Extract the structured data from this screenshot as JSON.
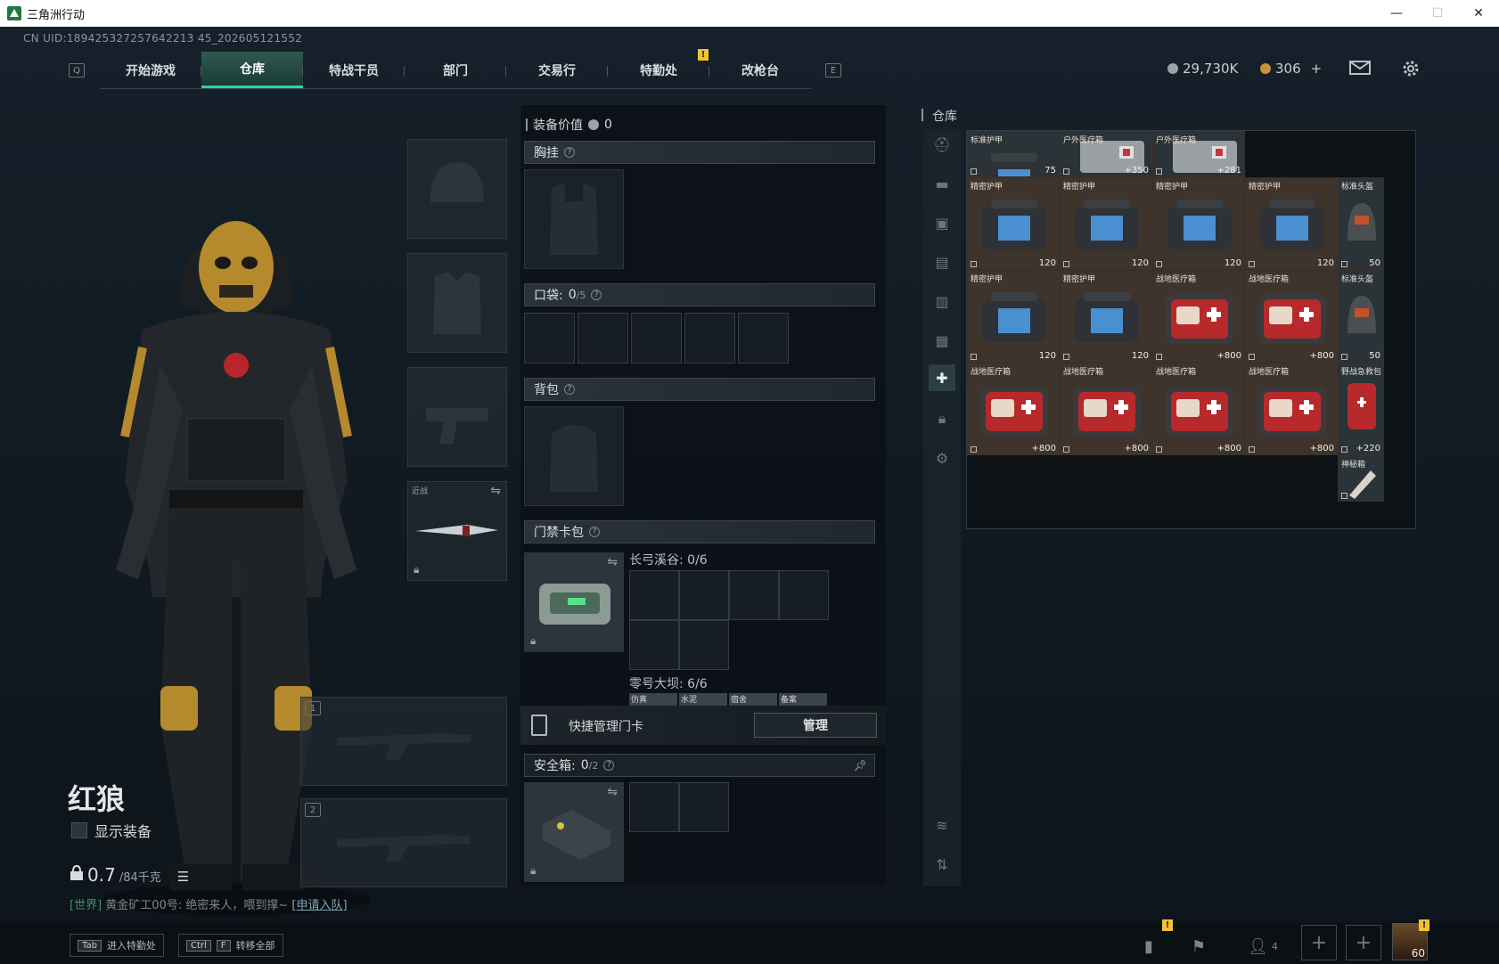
{
  "window": {
    "title": "三角洲行动",
    "min": "—",
    "max": "☐",
    "close": "✕"
  },
  "uid": "CN UID:189425327257642213 45_202605121552",
  "nav": {
    "left_key": "Q",
    "right_key": "E",
    "tabs": [
      "开始游戏",
      "仓库",
      "特战干员",
      "部门",
      "交易行",
      "特勤处",
      "改枪台"
    ],
    "active": 1,
    "badge": "!"
  },
  "currency": {
    "silver": "29,730K",
    "gold": "306",
    "plus": "+"
  },
  "character": {
    "name": "红狼",
    "show_equipment": "显示装备",
    "weight": "0.7",
    "weight_max": "/84千克"
  },
  "chat": {
    "channel": "[世界]",
    "msg": "黄金矿工00号: 绝密来人，喂到撑~",
    "join": "[申请入队]"
  },
  "equip_slots": {
    "melee_label": "近战",
    "weapon1": "1",
    "weapon2": "2"
  },
  "loadout": {
    "value_label": "装备价值",
    "value": "0",
    "chest": "胸挂",
    "pocket_label": "口袋:",
    "pocket_value": "0",
    "pocket_max": "/5",
    "backpack": "背包",
    "keycard_label": "门禁卡包",
    "keycard_area1": "长弓溪谷: 0/6",
    "keycard_area2": "零号大坝: 6/6",
    "keycard_chips": [
      "仿真",
      "水泥",
      "宿舍",
      "备案"
    ],
    "quick_manage": "快捷管理门卡",
    "manage_btn": "管理",
    "safebox_label": "安全箱:",
    "safebox_value": "0",
    "safebox_max": "/2"
  },
  "warehouse": {
    "title": "仓库",
    "items": [
      {
        "name": "标准护甲",
        "value": "75",
        "bg": "gr"
      },
      {
        "name": "户外医疗箱",
        "value": "+350",
        "bg": "gr"
      },
      {
        "name": "户外医疗箱",
        "value": "+281",
        "bg": "gr"
      },
      {
        "name": "精密护甲",
        "value": "120",
        "bg": "br"
      },
      {
        "name": "精密护甲",
        "value": "120",
        "bg": "br"
      },
      {
        "name": "精密护甲",
        "value": "120",
        "bg": "br"
      },
      {
        "name": "精密护甲",
        "value": "120",
        "bg": "br"
      },
      {
        "name": "标准头盔",
        "value": "50",
        "bg": "gr"
      },
      {
        "name": "精密护甲",
        "value": "120",
        "bg": "br"
      },
      {
        "name": "精密护甲",
        "value": "120",
        "bg": "br"
      },
      {
        "name": "战地医疗箱",
        "value": "+800",
        "bg": "br"
      },
      {
        "name": "战地医疗箱",
        "value": "+800",
        "bg": "br"
      },
      {
        "name": "标准头盔",
        "value": "50",
        "bg": "gr"
      },
      {
        "name": "战地医疗箱",
        "value": "+800",
        "bg": "br"
      },
      {
        "name": "战地医疗箱",
        "value": "+800",
        "bg": "br"
      },
      {
        "name": "战地医疗箱",
        "value": "+800",
        "bg": "br"
      },
      {
        "name": "战地医疗箱",
        "value": "+800",
        "bg": "br"
      },
      {
        "name": "野战急救包",
        "value": "+220",
        "bg": "gr"
      },
      {
        "name": "神秘箱",
        "value": "",
        "bg": "gr"
      }
    ]
  },
  "bottom": {
    "tab_key": "Tab",
    "tab_label": "进入特勤处",
    "ctrl_key": "Ctrl",
    "f_key": "F",
    "transfer_label": "转移全部",
    "friends": "4",
    "level": "60"
  }
}
